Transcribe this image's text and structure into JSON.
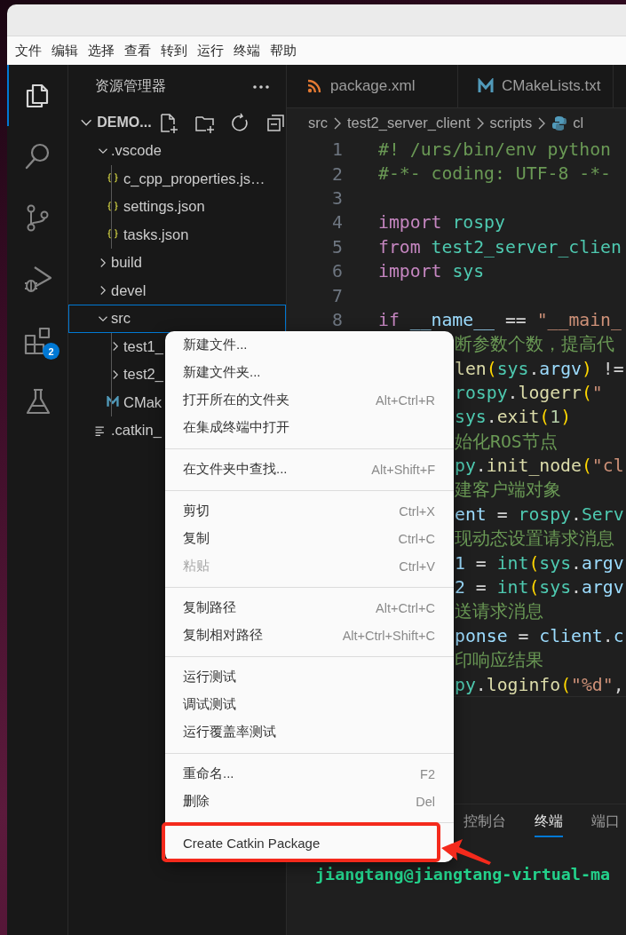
{
  "menu_bar": [
    "文件",
    "编辑",
    "选择",
    "查看",
    "转到",
    "运行",
    "终端",
    "帮助"
  ],
  "activity_bar": [
    {
      "kind": "explorer",
      "selected": true
    },
    {
      "kind": "search",
      "selected": false
    },
    {
      "kind": "source-control",
      "selected": false
    },
    {
      "kind": "run-debug",
      "selected": false
    },
    {
      "kind": "extensions",
      "selected": false,
      "badge": "2"
    },
    {
      "kind": "testing",
      "selected": false
    }
  ],
  "sidebar": {
    "title": "资源管理器",
    "root": {
      "name": "DEMO...",
      "expanded": true
    },
    "tree": [
      {
        "name": ".vscode",
        "kind": "folder",
        "expanded": true,
        "selected": false,
        "children": [
          {
            "name": "c_cpp_properties.js…",
            "kind": "json",
            "selected": false
          },
          {
            "name": "settings.json",
            "kind": "json",
            "selected": false
          },
          {
            "name": "tasks.json",
            "kind": "json",
            "selected": false
          }
        ]
      },
      {
        "name": "build",
        "kind": "folder",
        "expanded": false,
        "selected": false
      },
      {
        "name": "devel",
        "kind": "folder",
        "expanded": false,
        "selected": false
      },
      {
        "name": "src",
        "kind": "folder",
        "expanded": true,
        "selected": true,
        "children": [
          {
            "name": "test1_",
            "kind": "folder",
            "expanded": false,
            "selected": false
          },
          {
            "name": "test2_",
            "kind": "folder",
            "expanded": false,
            "selected": false
          },
          {
            "name": "CMak",
            "kind": "cmake",
            "selected": false
          }
        ]
      },
      {
        "name": ".catkin_",
        "kind": "text",
        "selected": false
      }
    ]
  },
  "tabs": [
    {
      "label": "package.xml",
      "kind": "rss",
      "selected": false
    },
    {
      "label": "CMakeLists.txt",
      "kind": "cmake",
      "selected": false
    }
  ],
  "breadcrumb": [
    {
      "label": "src",
      "kind": "folder"
    },
    {
      "label": "test2_server_client",
      "kind": "folder"
    },
    {
      "label": "scripts",
      "kind": "folder"
    },
    {
      "label": "cl",
      "kind": "python"
    }
  ],
  "code_lines": [
    {
      "number": "1",
      "tokens": [
        {
          "kind": "comment",
          "text": "#! /urs/bin/env python"
        }
      ]
    },
    {
      "number": "2",
      "tokens": [
        {
          "kind": "comment",
          "text": "#-*- coding: UTF-8 -*-"
        }
      ]
    },
    {
      "number": "3"
    },
    {
      "number": "4",
      "tokens": [
        {
          "kind": "keyword",
          "text": "import "
        },
        {
          "kind": "module",
          "text": "rospy"
        }
      ]
    },
    {
      "number": "5",
      "tokens": [
        {
          "kind": "keyword",
          "text": "from "
        },
        {
          "kind": "module",
          "text": "test2_server_clien"
        }
      ]
    },
    {
      "number": "6",
      "tokens": [
        {
          "kind": "keyword",
          "text": "import "
        },
        {
          "kind": "module",
          "text": "sys"
        }
      ]
    },
    {
      "number": "7"
    },
    {
      "number": "8",
      "tokens": [
        {
          "kind": "keyword",
          "text": "if "
        },
        {
          "kind": "variable",
          "text": "__name__"
        },
        {
          "kind": "plain",
          "text": " == "
        },
        {
          "kind": "string",
          "text": "\"__main_"
        }
      ]
    },
    {
      "tokens": [
        {
          "kind": "comment",
          "text": "断参数个数，提高代"
        }
      ]
    },
    {
      "tokens": [
        {
          "kind": "function",
          "text": "len"
        },
        {
          "kind": "bracket",
          "text": "("
        },
        {
          "kind": "module",
          "text": "sys"
        },
        {
          "kind": "plain",
          "text": "."
        },
        {
          "kind": "variable",
          "text": "argv"
        },
        {
          "kind": "bracket",
          "text": ")"
        },
        {
          "kind": "plain",
          "text": " !="
        }
      ]
    },
    {
      "tokens": [
        {
          "kind": "module",
          "text": "rospy"
        },
        {
          "kind": "plain",
          "text": "."
        },
        {
          "kind": "function",
          "text": "logerr"
        },
        {
          "kind": "bracket",
          "text": "("
        },
        {
          "kind": "string",
          "text": "\""
        }
      ]
    },
    {
      "tokens": [
        {
          "kind": "module",
          "text": "sys"
        },
        {
          "kind": "plain",
          "text": "."
        },
        {
          "kind": "function",
          "text": "exit"
        },
        {
          "kind": "bracket",
          "text": "("
        },
        {
          "kind": "number",
          "text": "1"
        },
        {
          "kind": "bracket",
          "text": ")"
        }
      ]
    },
    {
      "tokens": [
        {
          "kind": "comment",
          "text": "始化ROS节点"
        }
      ]
    },
    {
      "tokens": [
        {
          "kind": "module",
          "text": "py"
        },
        {
          "kind": "plain",
          "text": "."
        },
        {
          "kind": "function",
          "text": "init_node"
        },
        {
          "kind": "bracket",
          "text": "("
        },
        {
          "kind": "string",
          "text": "\"cl"
        }
      ]
    },
    {
      "tokens": [
        {
          "kind": "comment",
          "text": "建客户端对象"
        }
      ]
    },
    {
      "tokens": [
        {
          "kind": "variable",
          "text": "ent"
        },
        {
          "kind": "plain",
          "text": " = "
        },
        {
          "kind": "module",
          "text": "rospy"
        },
        {
          "kind": "plain",
          "text": "."
        },
        {
          "kind": "module",
          "text": "Serv"
        }
      ]
    },
    {
      "tokens": [
        {
          "kind": "comment",
          "text": "现动态设置请求消息"
        }
      ]
    },
    {
      "tokens": [
        {
          "kind": "variable",
          "text": "1"
        },
        {
          "kind": "plain",
          "text": " = "
        },
        {
          "kind": "module",
          "text": "int"
        },
        {
          "kind": "bracket",
          "text": "("
        },
        {
          "kind": "module",
          "text": "sys"
        },
        {
          "kind": "plain",
          "text": "."
        },
        {
          "kind": "variable",
          "text": "argv"
        }
      ]
    },
    {
      "tokens": [
        {
          "kind": "variable",
          "text": "2"
        },
        {
          "kind": "plain",
          "text": " = "
        },
        {
          "kind": "module",
          "text": "int"
        },
        {
          "kind": "bracket",
          "text": "("
        },
        {
          "kind": "module",
          "text": "sys"
        },
        {
          "kind": "plain",
          "text": "."
        },
        {
          "kind": "variable",
          "text": "argv"
        }
      ]
    },
    {
      "tokens": [
        {
          "kind": "comment",
          "text": "送请求消息"
        }
      ]
    },
    {
      "tokens": [
        {
          "kind": "variable",
          "text": "ponse"
        },
        {
          "kind": "plain",
          "text": " = "
        },
        {
          "kind": "variable",
          "text": "client"
        },
        {
          "kind": "plain",
          "text": "."
        },
        {
          "kind": "variable",
          "text": "c"
        }
      ]
    },
    {
      "tokens": [
        {
          "kind": "comment",
          "text": "印响应结果"
        }
      ]
    },
    {
      "tokens": [
        {
          "kind": "module",
          "text": "py"
        },
        {
          "kind": "plain",
          "text": "."
        },
        {
          "kind": "function",
          "text": "loginfo"
        },
        {
          "kind": "bracket",
          "text": "("
        },
        {
          "kind": "string",
          "text": "\"%d\""
        },
        {
          "kind": "plain",
          "text": ","
        }
      ]
    }
  ],
  "panel": {
    "tabs": [
      {
        "label": "控制台",
        "selected": false
      },
      {
        "label": "终端",
        "selected": true
      },
      {
        "label": "端口",
        "selected": false
      }
    ],
    "terminal": "jiangtang@jiangtang-virtual-ma"
  },
  "context_menu": [
    [
      {
        "label": "新建文件...",
        "disabled": false
      },
      {
        "label": "新建文件夹...",
        "disabled": false
      },
      {
        "label": "打开所在的文件夹",
        "shortcut": "Alt+Ctrl+R",
        "disabled": false
      },
      {
        "label": "在集成终端中打开",
        "disabled": false
      }
    ],
    [
      {
        "label": "在文件夹中查找...",
        "shortcut": "Alt+Shift+F",
        "disabled": false
      }
    ],
    [
      {
        "label": "剪切",
        "shortcut": "Ctrl+X",
        "disabled": false
      },
      {
        "label": "复制",
        "shortcut": "Ctrl+C",
        "disabled": false
      },
      {
        "label": "粘贴",
        "shortcut": "Ctrl+V",
        "disabled": true
      }
    ],
    [
      {
        "label": "复制路径",
        "shortcut": "Alt+Ctrl+C",
        "disabled": false
      },
      {
        "label": "复制相对路径",
        "shortcut": "Alt+Ctrl+Shift+C",
        "disabled": false
      }
    ],
    [
      {
        "label": "运行测试",
        "disabled": false
      },
      {
        "label": "调试测试",
        "disabled": false
      },
      {
        "label": "运行覆盖率测试",
        "disabled": false
      }
    ],
    [
      {
        "label": "重命名...",
        "shortcut": "F2",
        "disabled": false
      },
      {
        "label": "删除",
        "shortcut": "Del",
        "disabled": false
      }
    ],
    [
      {
        "label": "Create Catkin Package",
        "disabled": false,
        "highlighted": true
      }
    ]
  ]
}
